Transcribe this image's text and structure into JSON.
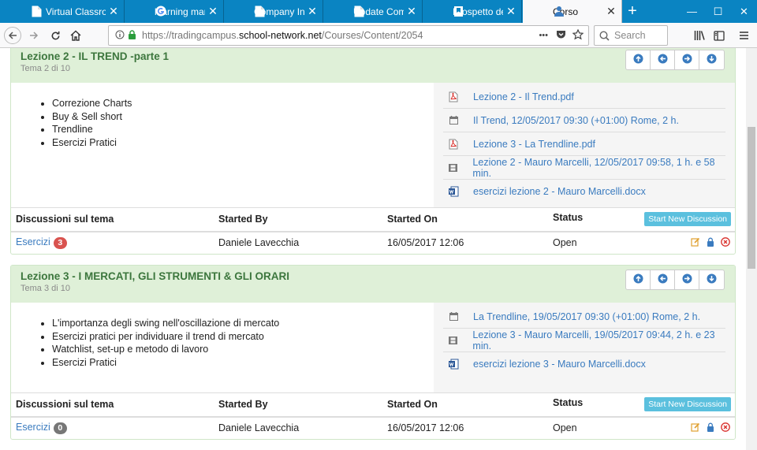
{
  "browser": {
    "tabs": [
      {
        "label": "Virtual Classroom",
        "icon": "page-icon"
      },
      {
        "label": "learning managem",
        "icon": "google-icon"
      },
      {
        "label": "Company Index",
        "icon": "page-icon"
      },
      {
        "label": "Update Company",
        "icon": "page-icon"
      },
      {
        "label": "Prospetto del cor",
        "icon": "bookmark-page-icon"
      },
      {
        "label": "Corso",
        "icon": "person-icon",
        "active": true
      }
    ],
    "close_glyph": "✕",
    "url_prefix": "https://tradingcampus.",
    "url_domain": "school-network.net",
    "url_path": "/Courses/Content/2054",
    "search_placeholder": "Search",
    "reader_dots": "•••"
  },
  "lessons": [
    {
      "title": "Lezione 2 - IL TREND -parte 1",
      "subtitle": "Tema 2 di 10",
      "topics": [
        "Correzione Charts",
        "Buy & Sell short",
        "Trendline",
        "Esercizi Pratici"
      ],
      "resources": [
        {
          "icon": "pdf-icon",
          "label": "Lezione 2 - Il Trend.pdf"
        },
        {
          "icon": "calendar-icon",
          "label": "Il Trend, 12/05/2017 09:30 (+01:00) Rome, 2 h."
        },
        {
          "icon": "pdf-icon",
          "label": "Lezione 3 - La Trendline.pdf"
        },
        {
          "icon": "video-icon",
          "label": "Lezione 2 - Mauro Marcelli, 12/05/2017 09:58, 1 h. e 58 min."
        },
        {
          "icon": "word-icon",
          "label": "esercizi lezione 2 - Mauro Marcelli.docx"
        }
      ],
      "discussion": {
        "topic": "Esercizi",
        "count": "3",
        "count_color": "#d9534f",
        "started_by": "Daniele Lavecchia",
        "started_on": "16/05/2017 12:06",
        "status": "Open"
      }
    },
    {
      "title": "Lezione 3 - I MERCATI, GLI STRUMENTI & GLI ORARI",
      "subtitle": "Tema 3 di 10",
      "topics": [
        "L'importanza degli swing nell'oscillazione di mercato",
        "Esercizi pratici per individuare il trend di mercato",
        "Watchlist, set-up e metodo di lavoro",
        "Esercizi Pratici"
      ],
      "resources": [
        {
          "icon": "calendar-icon",
          "label": "La Trendline, 19/05/2017 09:30 (+01:00) Rome, 2 h."
        },
        {
          "icon": "video-icon",
          "label": "Lezione 3 - Mauro Marcelli, 19/05/2017 09:44, 2 h. e 23 min."
        },
        {
          "icon": "word-icon",
          "label": "esercizi lezione 3 - Mauro Marcelli.docx"
        }
      ],
      "discussion": {
        "topic": "Esercizi",
        "count": "0",
        "count_color": "#777777",
        "started_by": "Daniele Lavecchia",
        "started_on": "16/05/2017 12:06",
        "status": "Open"
      }
    }
  ],
  "table_headers": {
    "topic": "Discussioni sul tema",
    "started_by": "Started By",
    "started_on": "Started On",
    "status": "Status",
    "new_button": "Start New Discussion"
  },
  "colors": {
    "browser_accent": "#0a84c2",
    "panel_header": "#dff0d8",
    "title_green": "#3c763d",
    "link_blue": "#3a7bbf",
    "info_button": "#5bc0de"
  }
}
